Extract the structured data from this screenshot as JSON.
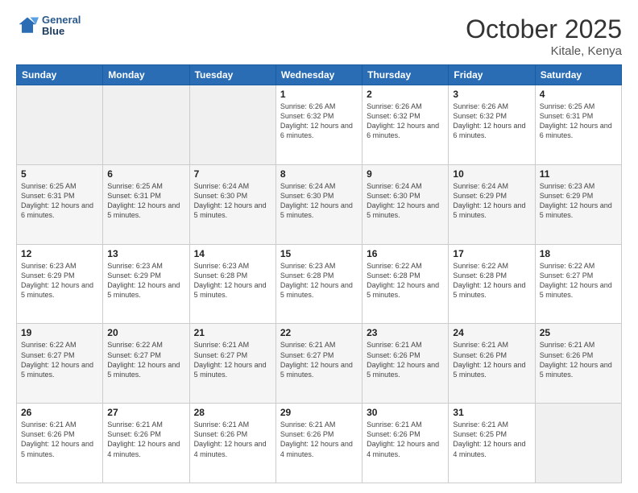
{
  "header": {
    "logo_line1": "General",
    "logo_line2": "Blue",
    "month": "October 2025",
    "location": "Kitale, Kenya"
  },
  "days_of_week": [
    "Sunday",
    "Monday",
    "Tuesday",
    "Wednesday",
    "Thursday",
    "Friday",
    "Saturday"
  ],
  "weeks": [
    [
      {
        "day": "",
        "info": "",
        "empty": true
      },
      {
        "day": "",
        "info": "",
        "empty": true
      },
      {
        "day": "",
        "info": "",
        "empty": true
      },
      {
        "day": "1",
        "info": "Sunrise: 6:26 AM\nSunset: 6:32 PM\nDaylight: 12 hours\nand 6 minutes."
      },
      {
        "day": "2",
        "info": "Sunrise: 6:26 AM\nSunset: 6:32 PM\nDaylight: 12 hours\nand 6 minutes."
      },
      {
        "day": "3",
        "info": "Sunrise: 6:26 AM\nSunset: 6:32 PM\nDaylight: 12 hours\nand 6 minutes."
      },
      {
        "day": "4",
        "info": "Sunrise: 6:25 AM\nSunset: 6:31 PM\nDaylight: 12 hours\nand 6 minutes."
      }
    ],
    [
      {
        "day": "5",
        "info": "Sunrise: 6:25 AM\nSunset: 6:31 PM\nDaylight: 12 hours\nand 6 minutes.",
        "shade": true
      },
      {
        "day": "6",
        "info": "Sunrise: 6:25 AM\nSunset: 6:31 PM\nDaylight: 12 hours\nand 5 minutes.",
        "shade": true
      },
      {
        "day": "7",
        "info": "Sunrise: 6:24 AM\nSunset: 6:30 PM\nDaylight: 12 hours\nand 5 minutes.",
        "shade": true
      },
      {
        "day": "8",
        "info": "Sunrise: 6:24 AM\nSunset: 6:30 PM\nDaylight: 12 hours\nand 5 minutes.",
        "shade": true
      },
      {
        "day": "9",
        "info": "Sunrise: 6:24 AM\nSunset: 6:30 PM\nDaylight: 12 hours\nand 5 minutes.",
        "shade": true
      },
      {
        "day": "10",
        "info": "Sunrise: 6:24 AM\nSunset: 6:29 PM\nDaylight: 12 hours\nand 5 minutes.",
        "shade": true
      },
      {
        "day": "11",
        "info": "Sunrise: 6:23 AM\nSunset: 6:29 PM\nDaylight: 12 hours\nand 5 minutes.",
        "shade": true
      }
    ],
    [
      {
        "day": "12",
        "info": "Sunrise: 6:23 AM\nSunset: 6:29 PM\nDaylight: 12 hours\nand 5 minutes."
      },
      {
        "day": "13",
        "info": "Sunrise: 6:23 AM\nSunset: 6:29 PM\nDaylight: 12 hours\nand 5 minutes."
      },
      {
        "day": "14",
        "info": "Sunrise: 6:23 AM\nSunset: 6:28 PM\nDaylight: 12 hours\nand 5 minutes."
      },
      {
        "day": "15",
        "info": "Sunrise: 6:23 AM\nSunset: 6:28 PM\nDaylight: 12 hours\nand 5 minutes."
      },
      {
        "day": "16",
        "info": "Sunrise: 6:22 AM\nSunset: 6:28 PM\nDaylight: 12 hours\nand 5 minutes."
      },
      {
        "day": "17",
        "info": "Sunrise: 6:22 AM\nSunset: 6:28 PM\nDaylight: 12 hours\nand 5 minutes."
      },
      {
        "day": "18",
        "info": "Sunrise: 6:22 AM\nSunset: 6:27 PM\nDaylight: 12 hours\nand 5 minutes."
      }
    ],
    [
      {
        "day": "19",
        "info": "Sunrise: 6:22 AM\nSunset: 6:27 PM\nDaylight: 12 hours\nand 5 minutes.",
        "shade": true
      },
      {
        "day": "20",
        "info": "Sunrise: 6:22 AM\nSunset: 6:27 PM\nDaylight: 12 hours\nand 5 minutes.",
        "shade": true
      },
      {
        "day": "21",
        "info": "Sunrise: 6:21 AM\nSunset: 6:27 PM\nDaylight: 12 hours\nand 5 minutes.",
        "shade": true
      },
      {
        "day": "22",
        "info": "Sunrise: 6:21 AM\nSunset: 6:27 PM\nDaylight: 12 hours\nand 5 minutes.",
        "shade": true
      },
      {
        "day": "23",
        "info": "Sunrise: 6:21 AM\nSunset: 6:26 PM\nDaylight: 12 hours\nand 5 minutes.",
        "shade": true
      },
      {
        "day": "24",
        "info": "Sunrise: 6:21 AM\nSunset: 6:26 PM\nDaylight: 12 hours\nand 5 minutes.",
        "shade": true
      },
      {
        "day": "25",
        "info": "Sunrise: 6:21 AM\nSunset: 6:26 PM\nDaylight: 12 hours\nand 5 minutes.",
        "shade": true
      }
    ],
    [
      {
        "day": "26",
        "info": "Sunrise: 6:21 AM\nSunset: 6:26 PM\nDaylight: 12 hours\nand 5 minutes."
      },
      {
        "day": "27",
        "info": "Sunrise: 6:21 AM\nSunset: 6:26 PM\nDaylight: 12 hours\nand 4 minutes."
      },
      {
        "day": "28",
        "info": "Sunrise: 6:21 AM\nSunset: 6:26 PM\nDaylight: 12 hours\nand 4 minutes."
      },
      {
        "day": "29",
        "info": "Sunrise: 6:21 AM\nSunset: 6:26 PM\nDaylight: 12 hours\nand 4 minutes."
      },
      {
        "day": "30",
        "info": "Sunrise: 6:21 AM\nSunset: 6:26 PM\nDaylight: 12 hours\nand 4 minutes."
      },
      {
        "day": "31",
        "info": "Sunrise: 6:21 AM\nSunset: 6:25 PM\nDaylight: 12 hours\nand 4 minutes."
      },
      {
        "day": "",
        "info": "",
        "empty": true
      }
    ]
  ]
}
